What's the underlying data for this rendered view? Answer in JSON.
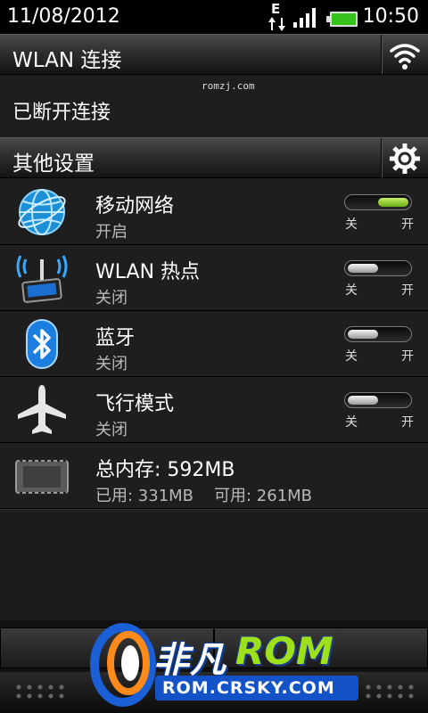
{
  "status_bar": {
    "date": "11/08/2012",
    "time": "10:50",
    "network_type": "E",
    "icons": [
      "data-arrows-icon",
      "signal-bars-icon",
      "battery-icon"
    ]
  },
  "wlan_section": {
    "title": "WLAN 连接",
    "status": "已断开连接",
    "watermark": "romzj.com",
    "icon": "wifi-icon"
  },
  "other_section": {
    "title": "其他设置",
    "icon": "gear-icon"
  },
  "rows": [
    {
      "title": "移动网络",
      "subtitle": "开启",
      "icon": "globe-icon",
      "toggle_on": true,
      "off_label": "关",
      "on_label": "开"
    },
    {
      "title": "WLAN 热点",
      "subtitle": "关闭",
      "icon": "hotspot-icon",
      "toggle_on": false,
      "off_label": "关",
      "on_label": "开"
    },
    {
      "title": "蓝牙",
      "subtitle": "关闭",
      "icon": "bluetooth-icon",
      "toggle_on": false,
      "off_label": "关",
      "on_label": "开"
    },
    {
      "title": "飞行模式",
      "subtitle": "关闭",
      "icon": "airplane-icon",
      "toggle_on": false,
      "off_label": "关",
      "on_label": "开"
    }
  ],
  "memory": {
    "title": "总内存: 592MB",
    "used": "已用: 331MB",
    "available": "可用: 261MB",
    "icon": "memory-chip-icon"
  },
  "overlay_logo": {
    "brand_cn": "非凡",
    "brand_rom": "ROM",
    "url": "ROM.CRSKY.COM"
  },
  "colors": {
    "toggle_on": "#8ed12a",
    "accent_blue": "#1353c7",
    "logo_green": "#9ee11a"
  }
}
